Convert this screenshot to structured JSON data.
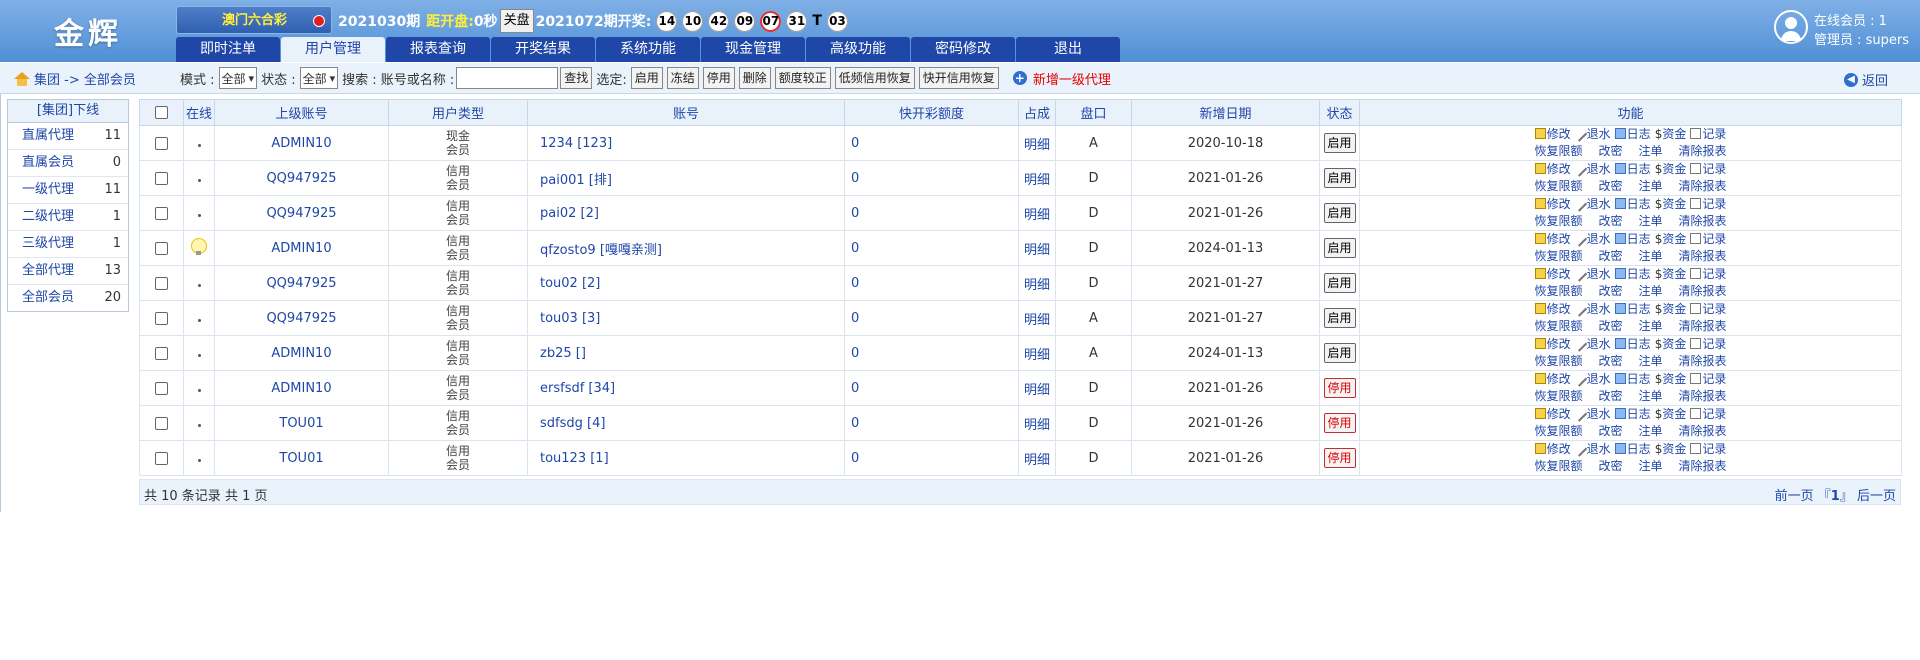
{
  "header": {
    "logo": "金辉",
    "game_select": "澳门六合彩",
    "period": "2021030期",
    "countdown_label": "距开盘:",
    "countdown_value": "0秒",
    "close_button": "关盘",
    "last_draw": "2021072期开奖:",
    "balls": [
      "14",
      "10",
      "42",
      "09",
      "07",
      "31"
    ],
    "special_label": "T",
    "special_ball": "03",
    "online_members": "在线会员 : 1",
    "admin": "管理员 : supers"
  },
  "nav": {
    "tabs": [
      "即时注单",
      "用户管理",
      "报表查询",
      "开奖结果",
      "系统功能",
      "现金管理",
      "高级功能",
      "密码修改",
      "退出"
    ],
    "active_index": 1
  },
  "toolbar": {
    "breadcrumb": "集团 -> 全部会员",
    "mode_label": "模式 :",
    "mode_value": "全部",
    "status_label": "状态 :",
    "status_value": "全部",
    "search_label": "搜索 : 账号或名称 :",
    "search_value": "",
    "search_button": "查找",
    "select_label": "选定:",
    "buttons": [
      "启用",
      "冻结",
      "停用",
      "删除",
      "额度较正",
      "低频信用恢复",
      "快开信用恢复"
    ],
    "add_agent": "新增一级代理",
    "back": "返回"
  },
  "sidebar": {
    "title": "[集团]下线",
    "items": [
      {
        "label": "直属代理",
        "count": "11"
      },
      {
        "label": "直属会员",
        "count": "0"
      },
      {
        "label": "一级代理",
        "count": "11"
      },
      {
        "label": "二级代理",
        "count": "1"
      },
      {
        "label": "三级代理",
        "count": "1"
      },
      {
        "label": "全部代理",
        "count": "13"
      },
      {
        "label": "全部会员",
        "count": "20"
      }
    ]
  },
  "table": {
    "headers": [
      "",
      "在线",
      "上级账号",
      "用户类型",
      "账号",
      "快开彩额度",
      "占成",
      "盘口",
      "新增日期",
      "状态",
      "功能"
    ],
    "rows": [
      {
        "online": false,
        "parent": "ADMIN10",
        "type": "现金会员",
        "account": "1234 [123]",
        "quota": "0",
        "share": "明细",
        "plate": "A",
        "date": "2020-10-18",
        "status": "启用",
        "status_red": false
      },
      {
        "online": false,
        "parent": "QQ947925",
        "type": "信用会员",
        "account": "pai001 [排]",
        "quota": "0",
        "share": "明细",
        "plate": "D",
        "date": "2021-01-26",
        "status": "启用",
        "status_red": false
      },
      {
        "online": false,
        "parent": "QQ947925",
        "type": "信用会员",
        "account": "pai02 [2]",
        "quota": "0",
        "share": "明细",
        "plate": "D",
        "date": "2021-01-26",
        "status": "启用",
        "status_red": false
      },
      {
        "online": true,
        "parent": "ADMIN10",
        "type": "信用会员",
        "account": "qfzosto9 [嘎嘎亲测]",
        "quota": "0",
        "share": "明细",
        "plate": "D",
        "date": "2024-01-13",
        "status": "启用",
        "status_red": false
      },
      {
        "online": false,
        "parent": "QQ947925",
        "type": "信用会员",
        "account": "tou02 [2]",
        "quota": "0",
        "share": "明细",
        "plate": "D",
        "date": "2021-01-27",
        "status": "启用",
        "status_red": false
      },
      {
        "online": false,
        "parent": "QQ947925",
        "type": "信用会员",
        "account": "tou03 [3]",
        "quota": "0",
        "share": "明细",
        "plate": "A",
        "date": "2021-01-27",
        "status": "启用",
        "status_red": false
      },
      {
        "online": false,
        "parent": "ADMIN10",
        "type": "信用会员",
        "account": "zb25 []",
        "quota": "0",
        "share": "明细",
        "plate": "A",
        "date": "2024-01-13",
        "status": "启用",
        "status_red": false
      },
      {
        "online": false,
        "parent": "ADMIN10",
        "type": "信用会员",
        "account": "ersfsdf [34]",
        "quota": "0",
        "share": "明细",
        "plate": "D",
        "date": "2021-01-26",
        "status": "停用",
        "status_red": true
      },
      {
        "online": false,
        "parent": "TOU01",
        "type": "信用会员",
        "account": "sdfsdg [4]",
        "quota": "0",
        "share": "明细",
        "plate": "D",
        "date": "2021-01-26",
        "status": "停用",
        "status_red": true
      },
      {
        "online": false,
        "parent": "TOU01",
        "type": "信用会员",
        "account": "tou123 [1]",
        "quota": "0",
        "share": "明细",
        "plate": "D",
        "date": "2021-01-26",
        "status": "停用",
        "status_red": true
      }
    ],
    "functions_line1": [
      "修改",
      "退水",
      "日志",
      "资金",
      "记录"
    ],
    "functions_line2": [
      "恢复限额",
      "改密",
      "注单",
      "清除报表"
    ]
  },
  "footer": {
    "summary": "共 10 条记录 共 1 页",
    "prev": "前一页",
    "page_left": "『",
    "page": "1",
    "page_right": "』",
    "next": "后一页"
  },
  "colors": {
    "header_blue": "#4f8fd6",
    "nav_blue": "#1f47a8",
    "light_bg": "#e9f1fb",
    "accent_red": "#e60000",
    "yellow": "#ffef3a"
  }
}
